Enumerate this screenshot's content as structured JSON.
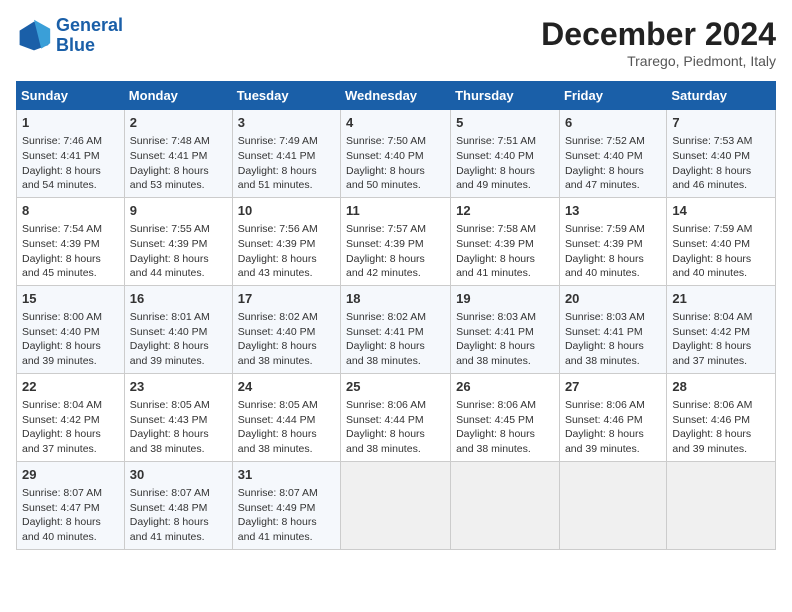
{
  "logo": {
    "line1": "General",
    "line2": "Blue"
  },
  "title": "December 2024",
  "location": "Trarego, Piedmont, Italy",
  "weekdays": [
    "Sunday",
    "Monday",
    "Tuesday",
    "Wednesday",
    "Thursday",
    "Friday",
    "Saturday"
  ],
  "weeks": [
    [
      {
        "day": "1",
        "info": "Sunrise: 7:46 AM\nSunset: 4:41 PM\nDaylight: 8 hours\nand 54 minutes."
      },
      {
        "day": "2",
        "info": "Sunrise: 7:48 AM\nSunset: 4:41 PM\nDaylight: 8 hours\nand 53 minutes."
      },
      {
        "day": "3",
        "info": "Sunrise: 7:49 AM\nSunset: 4:41 PM\nDaylight: 8 hours\nand 51 minutes."
      },
      {
        "day": "4",
        "info": "Sunrise: 7:50 AM\nSunset: 4:40 PM\nDaylight: 8 hours\nand 50 minutes."
      },
      {
        "day": "5",
        "info": "Sunrise: 7:51 AM\nSunset: 4:40 PM\nDaylight: 8 hours\nand 49 minutes."
      },
      {
        "day": "6",
        "info": "Sunrise: 7:52 AM\nSunset: 4:40 PM\nDaylight: 8 hours\nand 47 minutes."
      },
      {
        "day": "7",
        "info": "Sunrise: 7:53 AM\nSunset: 4:40 PM\nDaylight: 8 hours\nand 46 minutes."
      }
    ],
    [
      {
        "day": "8",
        "info": "Sunrise: 7:54 AM\nSunset: 4:39 PM\nDaylight: 8 hours\nand 45 minutes."
      },
      {
        "day": "9",
        "info": "Sunrise: 7:55 AM\nSunset: 4:39 PM\nDaylight: 8 hours\nand 44 minutes."
      },
      {
        "day": "10",
        "info": "Sunrise: 7:56 AM\nSunset: 4:39 PM\nDaylight: 8 hours\nand 43 minutes."
      },
      {
        "day": "11",
        "info": "Sunrise: 7:57 AM\nSunset: 4:39 PM\nDaylight: 8 hours\nand 42 minutes."
      },
      {
        "day": "12",
        "info": "Sunrise: 7:58 AM\nSunset: 4:39 PM\nDaylight: 8 hours\nand 41 minutes."
      },
      {
        "day": "13",
        "info": "Sunrise: 7:59 AM\nSunset: 4:39 PM\nDaylight: 8 hours\nand 40 minutes."
      },
      {
        "day": "14",
        "info": "Sunrise: 7:59 AM\nSunset: 4:40 PM\nDaylight: 8 hours\nand 40 minutes."
      }
    ],
    [
      {
        "day": "15",
        "info": "Sunrise: 8:00 AM\nSunset: 4:40 PM\nDaylight: 8 hours\nand 39 minutes."
      },
      {
        "day": "16",
        "info": "Sunrise: 8:01 AM\nSunset: 4:40 PM\nDaylight: 8 hours\nand 39 minutes."
      },
      {
        "day": "17",
        "info": "Sunrise: 8:02 AM\nSunset: 4:40 PM\nDaylight: 8 hours\nand 38 minutes."
      },
      {
        "day": "18",
        "info": "Sunrise: 8:02 AM\nSunset: 4:41 PM\nDaylight: 8 hours\nand 38 minutes."
      },
      {
        "day": "19",
        "info": "Sunrise: 8:03 AM\nSunset: 4:41 PM\nDaylight: 8 hours\nand 38 minutes."
      },
      {
        "day": "20",
        "info": "Sunrise: 8:03 AM\nSunset: 4:41 PM\nDaylight: 8 hours\nand 38 minutes."
      },
      {
        "day": "21",
        "info": "Sunrise: 8:04 AM\nSunset: 4:42 PM\nDaylight: 8 hours\nand 37 minutes."
      }
    ],
    [
      {
        "day": "22",
        "info": "Sunrise: 8:04 AM\nSunset: 4:42 PM\nDaylight: 8 hours\nand 37 minutes."
      },
      {
        "day": "23",
        "info": "Sunrise: 8:05 AM\nSunset: 4:43 PM\nDaylight: 8 hours\nand 38 minutes."
      },
      {
        "day": "24",
        "info": "Sunrise: 8:05 AM\nSunset: 4:44 PM\nDaylight: 8 hours\nand 38 minutes."
      },
      {
        "day": "25",
        "info": "Sunrise: 8:06 AM\nSunset: 4:44 PM\nDaylight: 8 hours\nand 38 minutes."
      },
      {
        "day": "26",
        "info": "Sunrise: 8:06 AM\nSunset: 4:45 PM\nDaylight: 8 hours\nand 38 minutes."
      },
      {
        "day": "27",
        "info": "Sunrise: 8:06 AM\nSunset: 4:46 PM\nDaylight: 8 hours\nand 39 minutes."
      },
      {
        "day": "28",
        "info": "Sunrise: 8:06 AM\nSunset: 4:46 PM\nDaylight: 8 hours\nand 39 minutes."
      }
    ],
    [
      {
        "day": "29",
        "info": "Sunrise: 8:07 AM\nSunset: 4:47 PM\nDaylight: 8 hours\nand 40 minutes."
      },
      {
        "day": "30",
        "info": "Sunrise: 8:07 AM\nSunset: 4:48 PM\nDaylight: 8 hours\nand 41 minutes."
      },
      {
        "day": "31",
        "info": "Sunrise: 8:07 AM\nSunset: 4:49 PM\nDaylight: 8 hours\nand 41 minutes."
      },
      null,
      null,
      null,
      null
    ]
  ]
}
